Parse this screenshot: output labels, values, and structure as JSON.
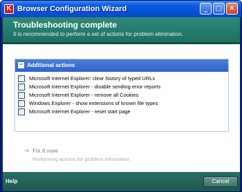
{
  "window": {
    "title": "Browser Configuration Wizard",
    "app_icon_glyph": "K",
    "controls": {
      "minimize_glyph": "_",
      "maximize_glyph": "□",
      "close_glyph": "✕"
    }
  },
  "header": {
    "title": "Troubleshooting complete",
    "subtitle": "It is recommended to perform a set of actions for problem elimination."
  },
  "actions_panel": {
    "title": "Additional actions",
    "collapse_glyph": "−",
    "items": [
      {
        "label": "Microsoft Internet Explorer: clear history of typed URLs",
        "checked": false
      },
      {
        "label": "Microsoft Internet Explorer - disable sending error reports",
        "checked": false
      },
      {
        "label": "Microsoft Internet Explorer - remove all Cookies",
        "checked": false
      },
      {
        "label": "Windows Explorer - show extensions of known file types",
        "checked": false
      },
      {
        "label": "Microsoft Internet Explorer - reset start page",
        "checked": false
      }
    ]
  },
  "fix": {
    "arrow_glyph": "➔",
    "title": "Fix it now",
    "subtitle": "Performing actions for problem elimination"
  },
  "footer": {
    "help_label": "Help",
    "cancel_label": "Cancel"
  },
  "colors": {
    "titlebar": "#0551d6",
    "header": "#2f8a79",
    "panel_header": "#3a6fd0",
    "footer": "#22625a"
  }
}
